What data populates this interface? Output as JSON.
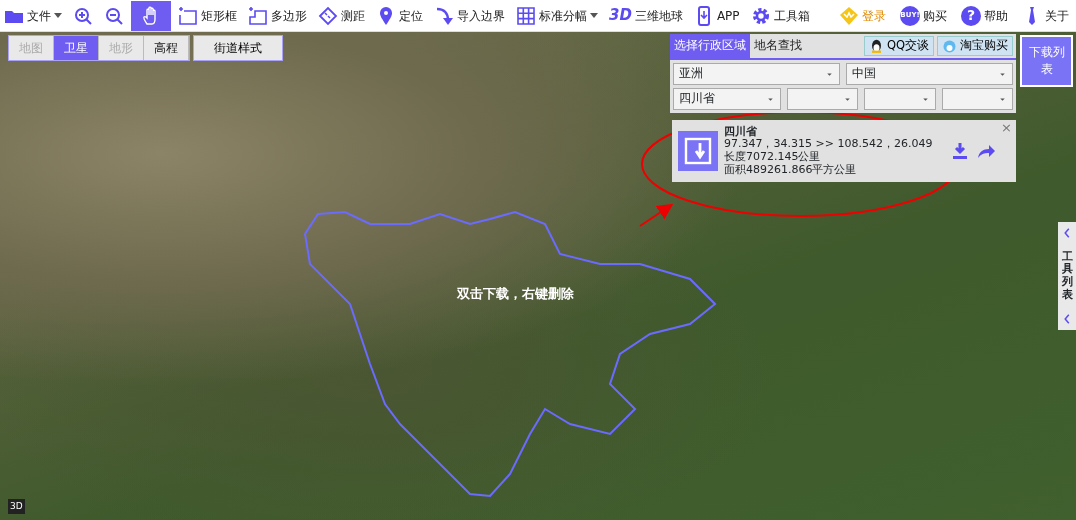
{
  "toolbar": {
    "left": [
      {
        "kind": "file",
        "label": "文件",
        "dropdown": true,
        "selected": false
      },
      {
        "kind": "zoom-in",
        "selected": false
      },
      {
        "kind": "zoom-out",
        "selected": false
      },
      {
        "kind": "pan",
        "selected": true
      },
      {
        "kind": "rect",
        "label": "矩形框",
        "selected": false
      },
      {
        "kind": "polygon",
        "label": "多边形",
        "selected": false
      },
      {
        "kind": "ruler",
        "label": "测距",
        "selected": false
      },
      {
        "kind": "pin",
        "label": "定位",
        "selected": false
      },
      {
        "kind": "import",
        "label": "导入边界",
        "selected": false
      },
      {
        "kind": "grid",
        "label": "标准分幅",
        "dropdown": true,
        "selected": false
      },
      {
        "kind": "globe",
        "badge": "3D",
        "label": "三维地球",
        "selected": false
      },
      {
        "kind": "phone",
        "label": "APP",
        "selected": false
      },
      {
        "kind": "gear",
        "label": "工具箱",
        "selected": false
      }
    ],
    "right": [
      {
        "kind": "login",
        "label": "登录"
      },
      {
        "kind": "buy",
        "badge": "BUY!",
        "label": "购买"
      },
      {
        "kind": "help",
        "badge": "?",
        "label": "帮助"
      },
      {
        "kind": "tie",
        "label": "关于"
      }
    ]
  },
  "map_types": [
    {
      "label": "地图",
      "selected": false,
      "disabled": true
    },
    {
      "label": "卫星",
      "selected": true,
      "disabled": false
    },
    {
      "label": "地形",
      "selected": false,
      "disabled": true
    },
    {
      "label": "高程",
      "selected": false,
      "disabled": false
    }
  ],
  "street_style": "街道样式",
  "map_hint": "双击下载，右键删除",
  "map_badge": "3D",
  "region_panel": {
    "tabs": [
      {
        "label": "选择行政区域",
        "selected": true
      },
      {
        "label": "地名查找",
        "selected": false
      }
    ],
    "buttons": [
      {
        "kind": "qq",
        "label": "QQ交谈"
      },
      {
        "kind": "taobao",
        "label": "淘宝购买"
      }
    ],
    "selects_row1": [
      {
        "kind": "filled",
        "value": "亚洲"
      },
      {
        "kind": "filled",
        "value": "中国"
      }
    ],
    "selects_row2": [
      {
        "kind": "filled",
        "value": "四川省"
      },
      {
        "kind": "empty"
      },
      {
        "kind": "empty"
      },
      {
        "kind": "empty"
      }
    ],
    "result": {
      "name": "四川省",
      "coords": "97.347，34.315 >> 108.542，26.049",
      "length": "长度7072.145公里",
      "area": "面积489261.866平方公里",
      "close": "×"
    }
  },
  "download_list": "下载列表",
  "side_tab": {
    "label": "工具列表"
  }
}
